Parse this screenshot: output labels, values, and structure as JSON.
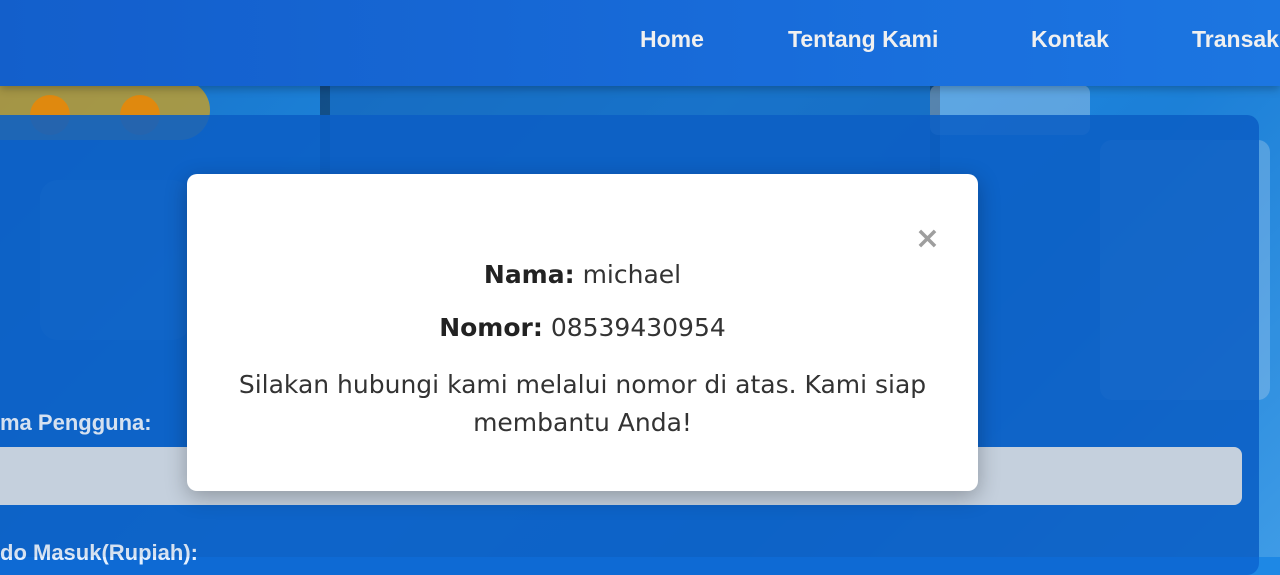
{
  "nav": {
    "items": [
      {
        "label": "Home"
      },
      {
        "label": "Tentang Kami"
      },
      {
        "label": "Kontak"
      },
      {
        "label": "Transak"
      }
    ]
  },
  "form": {
    "username_label": "ma Pengguna:",
    "balance_label": "do Masuk(Rupiah):"
  },
  "modal": {
    "close_icon": "×",
    "name_label": "Nama:",
    "name_value": "michael",
    "phone_label": "Nomor:",
    "phone_value": "08539430954",
    "message": "Silakan hubungi kami melalui nomor di atas. Kami siap membantu Anda!"
  },
  "colors": {
    "nav_bg": "#1a73e8",
    "panel_bg": "#0d65d2",
    "modal_bg": "#ffffff",
    "close_icon": "#9e9e9e"
  }
}
